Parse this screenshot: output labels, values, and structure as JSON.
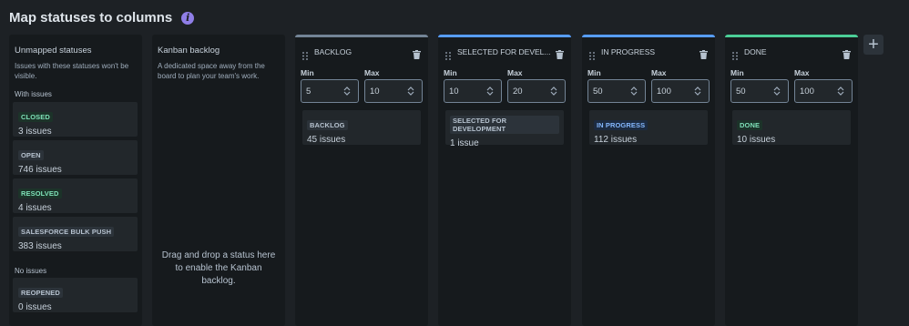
{
  "page": {
    "title": "Map statuses to columns"
  },
  "unmapped": {
    "heading": "Unmapped statuses",
    "subtitle": "Issues with these statuses won't be visible.",
    "with_issues_label": "With issues",
    "no_issues_label": "No issues",
    "with_issues": [
      {
        "name": "CLOSED",
        "count": "3 issues",
        "color": "green"
      },
      {
        "name": "OPEN",
        "count": "746 issues",
        "color": "grey"
      },
      {
        "name": "RESOLVED",
        "count": "4 issues",
        "color": "green"
      },
      {
        "name": "SALESFORCE BULK PUSH",
        "count": "383 issues",
        "color": "grey"
      }
    ],
    "no_issues": [
      {
        "name": "REOPENED",
        "count": "0 issues",
        "color": "grey"
      }
    ]
  },
  "kanban": {
    "heading": "Kanban backlog",
    "subtitle": "A dedicated space away from the board to plan your team's work.",
    "drop_hint": "Drag and drop a status here to enable the Kanban backlog."
  },
  "columns": [
    {
      "name": "BACKLOG",
      "accent": "#738496",
      "min_label": "Min",
      "max_label": "Max",
      "min": "5",
      "max": "10",
      "status": {
        "name": "BACKLOG",
        "count": "45 issues",
        "color": "grey"
      }
    },
    {
      "name": "SELECTED FOR DEVEL...",
      "accent": "#579dff",
      "min_label": "Min",
      "max_label": "Max",
      "min": "10",
      "max": "20",
      "status": {
        "name": "SELECTED FOR DEVELOPMENT",
        "count": "1 issue",
        "color": "grey"
      }
    },
    {
      "name": "IN PROGRESS",
      "accent": "#579dff",
      "min_label": "Min",
      "max_label": "Max",
      "min": "50",
      "max": "100",
      "status": {
        "name": "IN PROGRESS",
        "count": "112 issues",
        "color": "blue"
      }
    },
    {
      "name": "DONE",
      "accent": "#4bce97",
      "min_label": "Min",
      "max_label": "Max",
      "min": "50",
      "max": "100",
      "status": {
        "name": "DONE",
        "count": "10 issues",
        "color": "green"
      }
    }
  ],
  "icons": {
    "info": "info-icon",
    "drag": "drag-handle-icon",
    "trash": "trash-icon",
    "stepper": "chevron-up-down-icon",
    "add": "plus-icon"
  },
  "add_column_symbol": "+",
  "info_symbol": "i"
}
